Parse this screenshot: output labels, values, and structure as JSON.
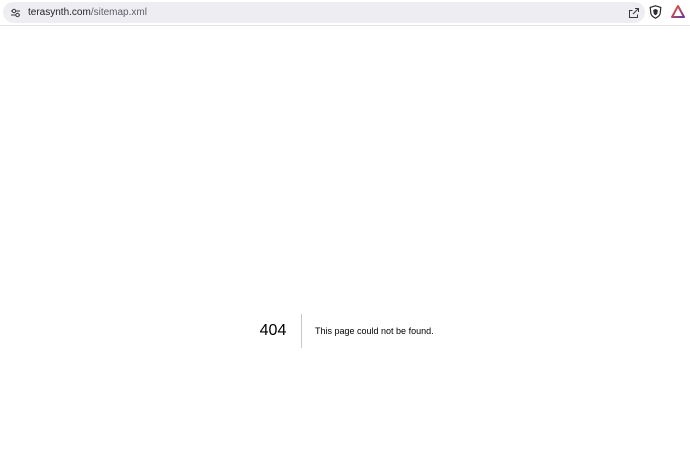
{
  "browser": {
    "url_domain": "terasynth.com",
    "url_path": "/sitemap.xml",
    "icons": {
      "site_settings": "tune-icon",
      "share": "share-icon",
      "shield": "brave-shield-icon",
      "rewards": "brave-rewards-icon"
    },
    "colors": {
      "omnibox_bg": "#eeeef2",
      "shield_orange": "#fb542b",
      "rewards_purple": "#6b3aa6"
    }
  },
  "error_page": {
    "code": "404",
    "message": "This page could not be found."
  }
}
